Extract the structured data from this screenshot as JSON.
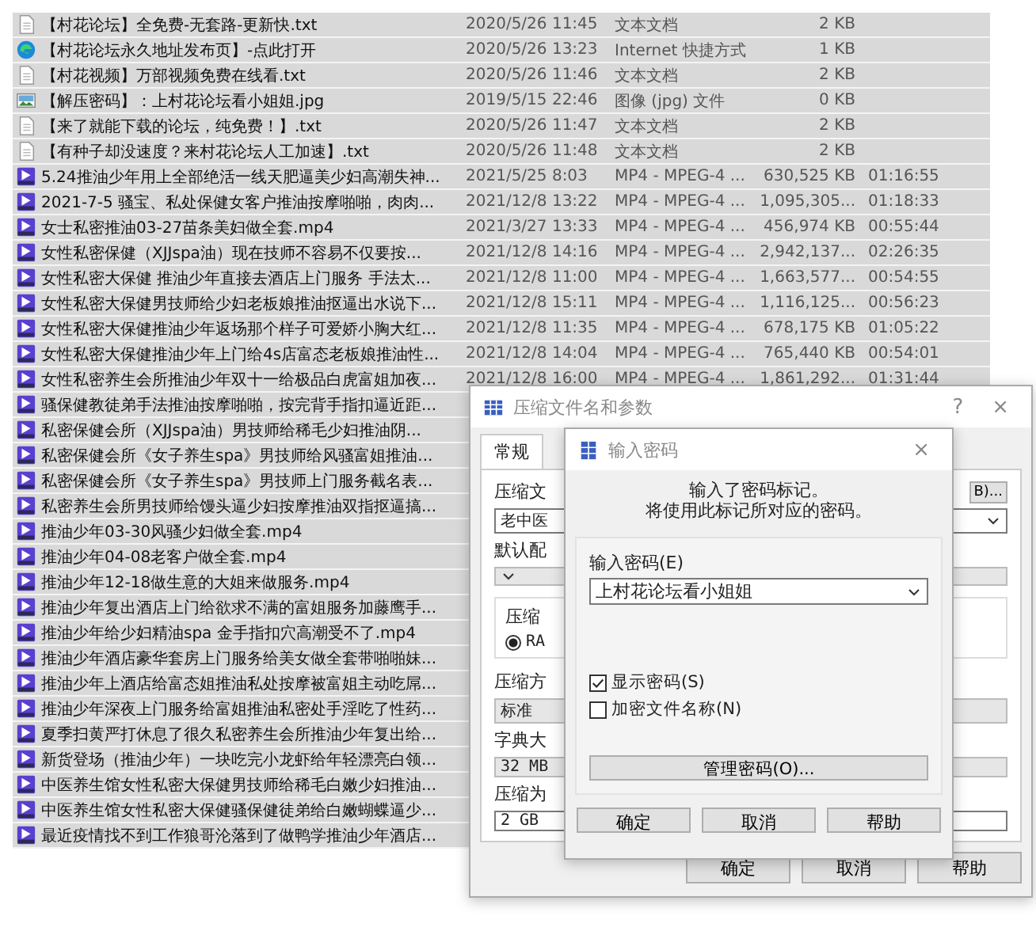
{
  "file_list": {
    "rows": [
      {
        "kind": "txt",
        "name": "【村花论坛】全免费-无套路-更新快.txt",
        "date": "2020/5/26 11:45",
        "type": "文本文档",
        "size": "2 KB"
      },
      {
        "kind": "url",
        "name": "【村花论坛永久地址发布页】-点此打开",
        "date": "2020/5/26 13:23",
        "type": "Internet 快捷方式",
        "size": "1 KB"
      },
      {
        "kind": "txt",
        "name": "【村花视频】万部视频免费在线看.txt",
        "date": "2020/5/26 11:46",
        "type": "文本文档",
        "size": "2 KB"
      },
      {
        "kind": "jpg",
        "name": "【解压密码】：上村花论坛看小姐姐.jpg",
        "date": "2019/5/15 22:46",
        "type": "图像 (jpg) 文件",
        "size": "0 KB"
      },
      {
        "kind": "txt",
        "name": "【来了就能下载的论坛，纯免费！】.txt",
        "date": "2020/5/26 11:47",
        "type": "文本文档",
        "size": "2 KB"
      },
      {
        "kind": "txt",
        "name": "【有种子却没速度？来村花论坛人工加速】.txt",
        "date": "2020/5/26 11:48",
        "type": "文本文档",
        "size": "2 KB"
      },
      {
        "kind": "mp4",
        "name": "5.24推油少年用上全部绝活一线天肥逼美少妇高潮失神...",
        "date": "2021/5/25 8:03",
        "type": "MP4 - MPEG-4 ...",
        "size": "630,525 KB",
        "duration": "01:16:55"
      },
      {
        "kind": "mp4",
        "name": "2021-7-5 骚宝、私处保健女客户推油按摩啪啪，肉肉...",
        "date": "2021/12/8 13:22",
        "type": "MP4 - MPEG-4 ...",
        "size": "1,095,305...",
        "duration": "01:18:33"
      },
      {
        "kind": "mp4",
        "name": "女士私密推油03-27苗条美妇做全套.mp4",
        "date": "2021/3/27 13:33",
        "type": "MP4 - MPEG-4 ...",
        "size": "456,974 KB",
        "duration": "00:55:44"
      },
      {
        "kind": "mp4",
        "name": "女性私密保健（XJJspa油）现在技师不容易不仅要按...",
        "date": "2021/12/8 14:16",
        "type": "MP4 - MPEG-4 ...",
        "size": "2,942,137...",
        "duration": "02:26:35"
      },
      {
        "kind": "mp4",
        "name": "女性私密大保健 推油少年直接去酒店上门服务 手法太...",
        "date": "2021/12/8 11:00",
        "type": "MP4 - MPEG-4 ...",
        "size": "1,663,577...",
        "duration": "00:54:55"
      },
      {
        "kind": "mp4",
        "name": "女性私密大保健男技师给少妇老板娘推油抠逼出水说下...",
        "date": "2021/12/8 15:11",
        "type": "MP4 - MPEG-4 ...",
        "size": "1,116,125...",
        "duration": "00:56:23"
      },
      {
        "kind": "mp4",
        "name": "女性私密大保健推油少年返场那个样子可爱娇小胸大红...",
        "date": "2021/12/8 11:35",
        "type": "MP4 - MPEG-4 ...",
        "size": "678,175 KB",
        "duration": "01:05:22"
      },
      {
        "kind": "mp4",
        "name": "女性私密大保健推油少年上门给4s店富态老板娘推油性...",
        "date": "2021/12/8 14:04",
        "type": "MP4 - MPEG-4 ...",
        "size": "765,440 KB",
        "duration": "00:54:01"
      },
      {
        "kind": "mp4",
        "name": "女性私密养生会所推油少年双十一给极品白虎富姐加夜...",
        "date": "2021/12/8 16:00",
        "type": "MP4 - MPEG-4 ...",
        "size": "1,861,292...",
        "duration": "01:31:44"
      },
      {
        "kind": "mp4",
        "name": "骚保健教徒弟手法推油按摩啪啪，按完背手指扣逼近距..."
      },
      {
        "kind": "mp4",
        "name": "私密保健会所（XJJspa油）男技师给稀毛少妇推油阴..."
      },
      {
        "kind": "mp4",
        "name": "私密保健会所《女子养生spa》男技师给风骚富姐推油..."
      },
      {
        "kind": "mp4",
        "name": "私密保健会所《女子养生spa》男技师上门服务截名表..."
      },
      {
        "kind": "mp4",
        "name": "私密养生会所男技师给馒头逼少妇按摩推油双指抠逼搞..."
      },
      {
        "kind": "mp4",
        "name": "推油少年03-30风骚少妇做全套.mp4"
      },
      {
        "kind": "mp4",
        "name": "推油少年04-08老客户做全套.mp4"
      },
      {
        "kind": "mp4",
        "name": "推油少年12-18做生意的大姐来做服务.mp4"
      },
      {
        "kind": "mp4",
        "name": "推油少年复出酒店上门给欲求不满的富姐服务加藤鹰手..."
      },
      {
        "kind": "mp4",
        "name": "推油少年给少妇精油spa 金手指扣穴高潮受不了.mp4"
      },
      {
        "kind": "mp4",
        "name": "推油少年酒店豪华套房上门服务给美女做全套带啪啪妹..."
      },
      {
        "kind": "mp4",
        "name": "推油少年上酒店给富态姐推油私处按摩被富姐主动吃屌..."
      },
      {
        "kind": "mp4",
        "name": "推油少年深夜上门服务给富姐推油私密处手淫吃了性药..."
      },
      {
        "kind": "mp4",
        "name": "夏季扫黄严打休息了很久私密养生会所推油少年复出给..."
      },
      {
        "kind": "mp4",
        "name": "新货登场（推油少年）一块吃完小龙虾给年轻漂亮白领..."
      },
      {
        "kind": "mp4",
        "name": "中医养生馆女性私密大保健男技师给稀毛白嫩少妇推油..."
      },
      {
        "kind": "mp4",
        "name": "中医养生馆女性私密大保健骚保健徒弟给白嫩蝴蝶逼少..."
      },
      {
        "kind": "mp4",
        "name": "最近疫情找不到工作狼哥沦落到了做鸭学推油少年酒店..."
      }
    ]
  },
  "archive_dialog": {
    "title": "压缩文件名和参数",
    "help": "?",
    "close": "×",
    "tabs": [
      {
        "label": "常规",
        "selected": true
      }
    ],
    "browse_button": "B)...",
    "controls": [
      {
        "kind": "label",
        "text": "压缩文"
      },
      {
        "kind": "combo",
        "value": "老中医",
        "disabled": false
      },
      {
        "kind": "label",
        "text": "默认配"
      },
      {
        "kind": "combo",
        "disabled": true
      },
      {
        "kind": "group",
        "legend": "压缩",
        "option": "RA",
        "selected": true
      },
      {
        "kind": "label",
        "text": "压缩方"
      },
      {
        "kind": "field",
        "value": "标准",
        "disabled": true
      },
      {
        "kind": "label",
        "text": "字典大"
      },
      {
        "kind": "field",
        "value": "32 MB",
        "disabled": true
      },
      {
        "kind": "label",
        "text": "压缩为"
      },
      {
        "kind": "field",
        "value": "2 GB",
        "disabled": false
      }
    ],
    "buttons": [
      "确定",
      "取消",
      "帮助"
    ]
  },
  "password_dialog": {
    "title": "输入密码",
    "close": "×",
    "message": [
      "输入了密码标记。",
      "将使用此标记所对应的密码。"
    ],
    "password_label": "输入密码(E)",
    "password_value": "上村花论坛看小姐姐",
    "options": [
      {
        "label": "显示密码(S)",
        "checked": true
      },
      {
        "label": "加密文件名称(N)",
        "checked": false
      }
    ],
    "manage_button": "管理密码(O)...",
    "buttons": [
      "确定",
      "取消",
      "帮助"
    ]
  }
}
